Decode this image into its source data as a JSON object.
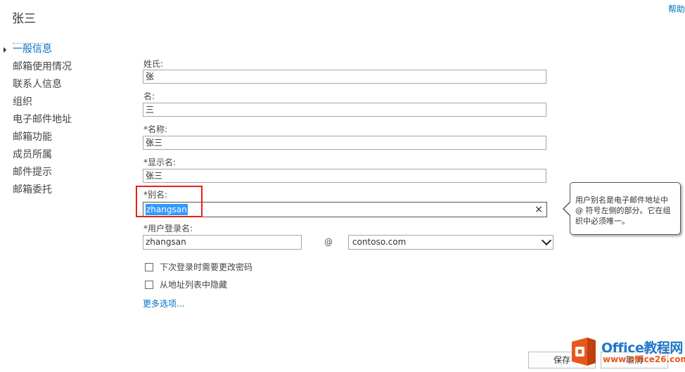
{
  "header": {
    "title": "张三",
    "help_label": "帮助"
  },
  "nav": {
    "items": [
      {
        "label": "一般信息",
        "selected": true
      },
      {
        "label": "邮箱使用情况"
      },
      {
        "label": "联系人信息"
      },
      {
        "label": "组织"
      },
      {
        "label": "电子邮件地址"
      },
      {
        "label": "邮箱功能"
      },
      {
        "label": "成员所属"
      },
      {
        "label": "邮件提示"
      },
      {
        "label": "邮箱委托"
      }
    ]
  },
  "form": {
    "last_name": {
      "label": "姓氏:",
      "value": "张"
    },
    "first_name": {
      "label": "名:",
      "value": "三"
    },
    "name": {
      "label": "*名称:",
      "value": "张三"
    },
    "display_name": {
      "label": "*显示名:",
      "value": "张三"
    },
    "alias": {
      "label": "*别名:",
      "value": "zhangsan",
      "clear_icon": "×"
    },
    "user_logon": {
      "label": "*用户登录名:",
      "value": "zhangsan",
      "at": "@",
      "domain": "contoso.com"
    },
    "checkboxes": [
      {
        "label": "下次登录时需要更改密码",
        "checked": false
      },
      {
        "label": "从地址列表中隐藏",
        "checked": false
      }
    ],
    "more_options": "更多选项..."
  },
  "tooltip": {
    "text": "用户别名是电子邮件地址中 @ 符号左侧的部分。它在组织中必须唯一。"
  },
  "footer": {
    "save_label": "保存",
    "cancel_label": "取消"
  },
  "watermark": {
    "title": "Office教程网",
    "url": "www.office26.com"
  },
  "colors": {
    "accent": "#0072c6",
    "highlight_box": "#e8201c",
    "selection": "#3399ff",
    "logo": "#e8571d"
  }
}
